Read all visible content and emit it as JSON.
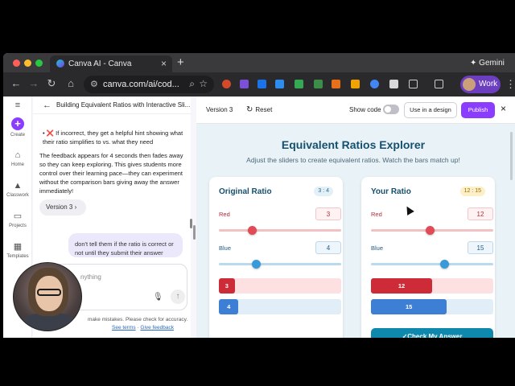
{
  "browser": {
    "tab_title": "Canva AI - Canva",
    "tab_close": "×",
    "new_tab": "+",
    "gemini_label": "Gemini",
    "url": "canva.com/ai/cod...",
    "profile_name": "Work",
    "colors": {
      "tabstrip": "#3a3a3c",
      "toolbar": "#2a2a2c",
      "profile": "#6c3fc0"
    }
  },
  "rail": {
    "create": "Create",
    "home": "Home",
    "classwork": "Classwork",
    "projects": "Projects",
    "templates": "Templates"
  },
  "chat": {
    "title": "Building Equivalent Ratios with Interactive Sli...",
    "message_bullet_icon": "❌",
    "message_bullet": "If incorrect, they get a helpful hint showing what their ratio simplifies to vs. what they need",
    "message_body": "The feedback appears for 4 seconds then fades away so they can keep exploring. This gives students more control over their learning pace—they can experiment without the comparison bars giving away the answer immediately!",
    "version_chip": "Version 3",
    "user_message": "don't tell them if the ratio is correct or not until they submit their answer",
    "composer_placeholder": "nything",
    "disclaimer": "make mistakes. Please check for accuracy.",
    "link_terms": "See terms",
    "link_feedback": "Give feedback",
    "link_sep": " · "
  },
  "preview": {
    "version": "Version 3",
    "reset": "Reset",
    "show_code": "Show code",
    "use_in_design": "Use in a design",
    "publish": "Publish",
    "close": "×",
    "app_title": "Equivalent Ratios Explorer",
    "app_subtitle": "Adjust the sliders to create equivalent ratios. Watch the bars match up!",
    "original": {
      "title": "Original Ratio",
      "badge": "3 : 4",
      "red_label": "Red",
      "red_value": "3",
      "blue_label": "Blue",
      "blue_value": "4",
      "red_bar": "3",
      "blue_bar": "4",
      "red_fraction": 0.27,
      "blue_fraction": 0.3,
      "red_bar_fraction": 0.13,
      "blue_bar_fraction": 0.16
    },
    "yours": {
      "title": "Your Ratio",
      "badge": "12 : 15",
      "red_label": "Red",
      "red_value": "12",
      "blue_label": "Blue",
      "blue_value": "15",
      "red_bar": "12",
      "blue_bar": "15",
      "red_fraction": 0.48,
      "blue_fraction": 0.6,
      "red_bar_fraction": 0.5,
      "blue_bar_fraction": 0.62
    },
    "check_button": "✓Check My Answer",
    "colors": {
      "accent": "#8b3dff",
      "title": "#15506e",
      "red": "#cd2b38",
      "blue": "#3e7fd6",
      "check": "#0e89ad"
    }
  }
}
